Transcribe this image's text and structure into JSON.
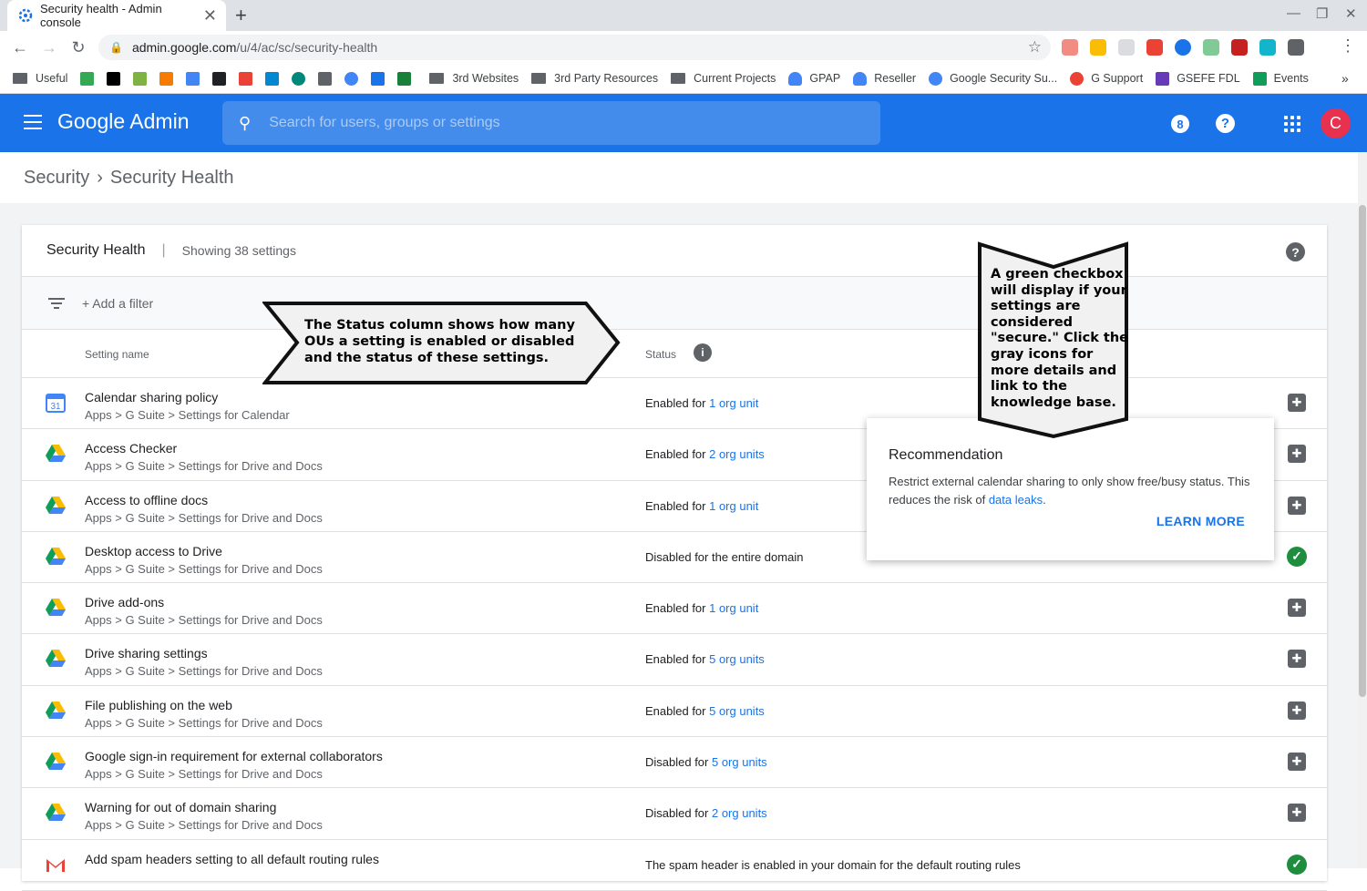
{
  "browser": {
    "tab_title": "Security health - Admin console",
    "url_host": "admin.google.com",
    "url_path": "/u/4/ac/sc/security-health",
    "bookmarks": [
      "Useful",
      "3rd Websites",
      "3rd Party Resources",
      "Current Projects",
      "GPAP",
      "Reseller",
      "Google Security Su...",
      "G Support",
      "GSEFE FDL",
      "Events"
    ]
  },
  "app": {
    "logo": "Google Admin",
    "search_placeholder": "Search for users, groups or settings",
    "notification_count": "8",
    "avatar_letter": "C"
  },
  "breadcrumb": {
    "parent": "Security",
    "current": "Security Health"
  },
  "card": {
    "title": "Security Health",
    "count": "Showing 38 settings",
    "add_filter": "+ Add a filter",
    "col_setting": "Setting name",
    "col_status": "Status"
  },
  "rows": [
    {
      "name": "Calendar sharing policy",
      "path": "Apps > G Suite > Settings for Calendar",
      "status_prefix": "Enabled for ",
      "status_link": "1 org unit",
      "icon": "calendar-icon",
      "state": "action"
    },
    {
      "name": "Access Checker",
      "path": "Apps > G Suite > Settings for Drive and Docs",
      "status_prefix": "Enabled for ",
      "status_link": "2 org units",
      "icon": "drive-icon",
      "state": "action"
    },
    {
      "name": "Access to offline docs",
      "path": "Apps > G Suite > Settings for Drive and Docs",
      "status_prefix": "Enabled for ",
      "status_link": "1 org unit",
      "icon": "drive-icon",
      "state": "action"
    },
    {
      "name": "Desktop access to Drive",
      "path": "Apps > G Suite > Settings for Drive and Docs",
      "status_prefix": "Disabled for the entire domain",
      "status_link": "",
      "icon": "drive-icon",
      "state": "ok"
    },
    {
      "name": "Drive add-ons",
      "path": "Apps > G Suite > Settings for Drive and Docs",
      "status_prefix": "Enabled for ",
      "status_link": "1 org unit",
      "icon": "drive-icon",
      "state": "action"
    },
    {
      "name": "Drive sharing settings",
      "path": "Apps > G Suite > Settings for Drive and Docs",
      "status_prefix": "Enabled for ",
      "status_link": "5 org units",
      "icon": "drive-icon",
      "state": "action"
    },
    {
      "name": "File publishing on the web",
      "path": "Apps > G Suite > Settings for Drive and Docs",
      "status_prefix": "Enabled for ",
      "status_link": "5 org units",
      "icon": "drive-icon",
      "state": "action"
    },
    {
      "name": "Google sign-in requirement for external collaborators",
      "path": "Apps > G Suite > Settings for Drive and Docs",
      "status_prefix": "Disabled for ",
      "status_link": "5 org units",
      "icon": "drive-icon",
      "state": "action"
    },
    {
      "name": "Warning for out of domain sharing",
      "path": "Apps > G Suite > Settings for Drive and Docs",
      "status_prefix": "Disabled for ",
      "status_link": "2 org units",
      "icon": "drive-icon",
      "state": "action"
    },
    {
      "name": "Add spam headers setting to all default routing rules",
      "path": "",
      "status_prefix": "The spam header is enabled in your domain for the default routing rules",
      "status_link": "",
      "icon": "gmail-icon",
      "state": "ok"
    }
  ],
  "recommendation": {
    "title": "Recommendation",
    "body_before": "Restrict external calendar sharing to only show free/busy status. This reduces the risk of ",
    "body_link": "data leaks",
    "body_after": ".",
    "learn_more": "LEARN MORE"
  },
  "callouts": {
    "status_lines": [
      "The Status column shows how many",
      "OUs a setting is enabled or disabled",
      "and the status of these settings."
    ],
    "checkbox_lines": [
      "A green checkbox",
      "will display if your",
      "settings are",
      "considered",
      "\"secure.\" Click the",
      "gray icons for",
      "more details and",
      "link to the",
      "knowledge base."
    ]
  },
  "colors": {
    "brand": "#1a73e8",
    "ok": "#1e8e3e",
    "avatar": "#e8304f"
  }
}
